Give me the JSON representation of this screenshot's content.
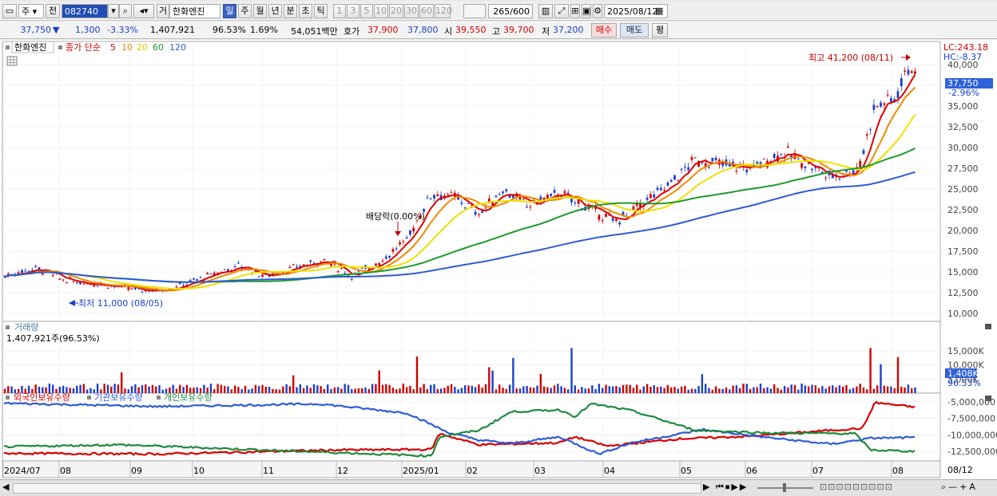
{
  "toolbar": {
    "market_dd": "주",
    "all_label": "전",
    "code": "082740",
    "inst_label": "거",
    "stock_name": "한화엔진",
    "periods": [
      "일",
      "주",
      "월",
      "년",
      "분",
      "초",
      "틱"
    ],
    "active_period": "일",
    "intervals": [
      "1",
      "3",
      "5",
      "10",
      "20",
      "30",
      "60",
      "120"
    ],
    "count": "265",
    "count_max": "/600",
    "date": "2025/08/12"
  },
  "quote": {
    "price": "37,750",
    "arrow": "▼",
    "change": "1,300",
    "change_pct": "-3.33%",
    "volume": "1,407,921",
    "vol_ratio": "96.53%",
    "turnover": "1.69%",
    "amount": "54,051백만",
    "hoga_label": "호가",
    "ask": "37,900",
    "bid": "37,800",
    "open_label": "시",
    "open": "39,550",
    "high_label": "고",
    "high": "39,700",
    "low_label": "저",
    "low": "37,200",
    "buy": "매수",
    "sell": "매도",
    "eval": "평"
  },
  "price_panel": {
    "name": "한화엔진",
    "indicator": "종가 단순",
    "ma": [
      "5",
      "10",
      "20",
      "60",
      "120"
    ],
    "ma_colors": [
      "#e00000",
      "#f08a00",
      "#f0e000",
      "#1e9a2e",
      "#2f5bd8"
    ],
    "lc": "LC:243.18",
    "hc": "HC:-8.37",
    "last_price": "37,750",
    "last_pct": "-2.96%",
    "high_note": "최고 41,200 (08/11)",
    "low_note": "최저 11,000 (08/05)",
    "dividend_note": "배당락(0.00%)",
    "y_labels": [
      "40,000",
      "37,500",
      "35,000",
      "32,500",
      "30,000",
      "27,500",
      "25,000",
      "22,500",
      "20,000",
      "17,500",
      "15,000",
      "12,500",
      "10,000"
    ]
  },
  "volume_panel": {
    "title": "거래량",
    "summary": "1,407,921주(96.53%)",
    "y_labels": [
      "15,000K",
      "10,000K",
      "5,000K"
    ],
    "last_value": "1,408K",
    "last_pct": "96.53%"
  },
  "holdings_panel": {
    "series": [
      {
        "name": "외국인보유수량",
        "color": "#d80000"
      },
      {
        "name": "기관보유수량",
        "color": "#2f5bd8"
      },
      {
        "name": "개인보유수량",
        "color": "#1e8a3e"
      }
    ],
    "y_labels": [
      "-5,000,000",
      "-7,500,000",
      "-10,000,000",
      "-12,500,000"
    ]
  },
  "x_axis": {
    "labels": [
      "2024/07",
      "08",
      "09",
      "10",
      "11",
      "12",
      "2025/01",
      "02",
      "03",
      "04",
      "05",
      "06",
      "07",
      "08"
    ],
    "end_label": "08/12"
  }
}
